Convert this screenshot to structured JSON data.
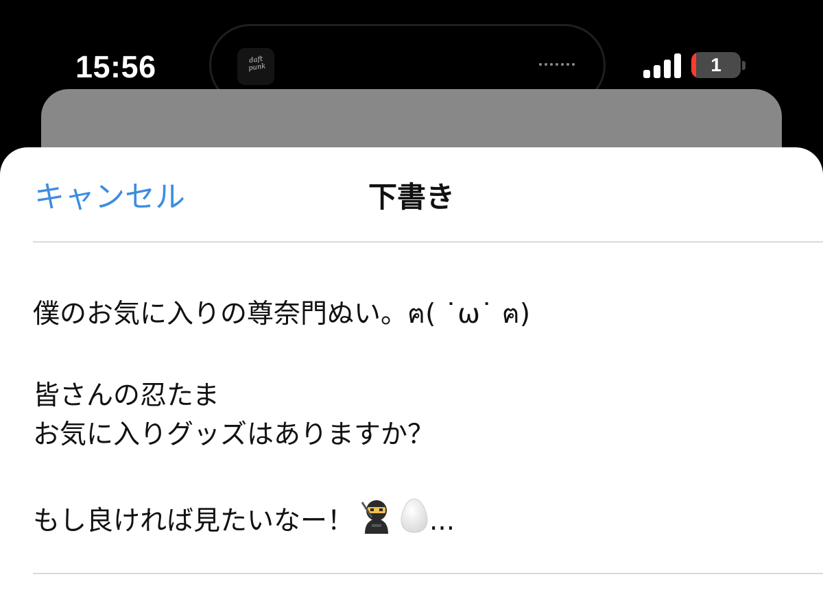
{
  "status_bar": {
    "time": "15:56",
    "battery_level": "1",
    "battery_fill_fraction": 0.1,
    "signal_bars": 4,
    "now_playing_art_text": "daft\npunk",
    "icons": [
      "signal-bars-icon",
      "battery-icon"
    ]
  },
  "compose_sheet": {
    "cancel_label": "キャンセル",
    "title": "下書き",
    "draft_lines": [
      "僕のお気に入りの尊奈門ぬい。ฅ( ˙ω˙ ฅ)",
      "皆さんの忍たま",
      "お気に入りグッズはありますか？",
      "もし良ければ見たいなー！"
    ],
    "trailing_emojis": [
      "ninja-icon",
      "egg-icon"
    ],
    "ellipsis": "..."
  },
  "colors": {
    "accent": "#3d8de0",
    "text": "#111111",
    "battery_low": "#ff3b30",
    "background_sheet": "#888888"
  }
}
